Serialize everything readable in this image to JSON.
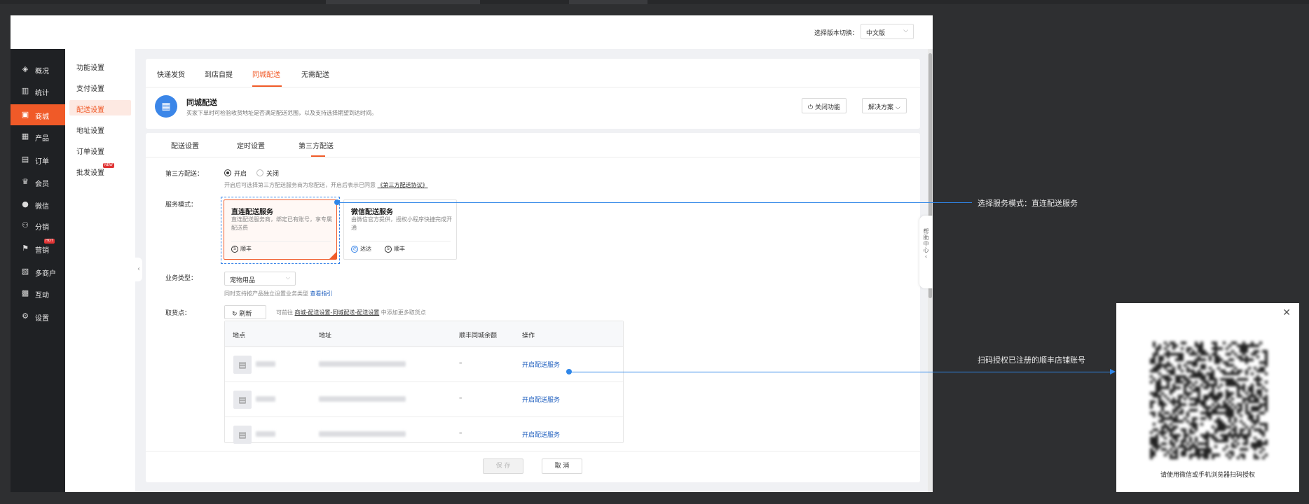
{
  "header": {
    "lang_label": "选择版本切换：",
    "lang_value": "中文版"
  },
  "sidebar": {
    "items": [
      {
        "label": "概况",
        "icon": "layers-icon",
        "glyph": "◈"
      },
      {
        "label": "统计",
        "icon": "chart-icon",
        "glyph": "▥"
      },
      {
        "label": "商城",
        "icon": "shop-icon",
        "glyph": "▣"
      },
      {
        "label": "产品",
        "icon": "grid-icon",
        "glyph": "▦"
      },
      {
        "label": "订单",
        "icon": "order-icon",
        "glyph": "▤"
      },
      {
        "label": "会员",
        "icon": "crown-icon",
        "glyph": "♛"
      },
      {
        "label": "微信",
        "icon": "wechat-icon",
        "glyph": "●"
      },
      {
        "label": "分销",
        "icon": "distribution-icon",
        "glyph": "⚇"
      },
      {
        "label": "营销",
        "icon": "flag-icon",
        "glyph": "⚑",
        "badge": "HOT"
      },
      {
        "label": "多商户",
        "icon": "merchant-icon",
        "glyph": "▧"
      },
      {
        "label": "互动",
        "icon": "interact-icon",
        "glyph": "▩"
      },
      {
        "label": "设置",
        "icon": "gear-icon",
        "glyph": "⚙"
      }
    ]
  },
  "subnav": {
    "items": [
      {
        "label": "功能设置"
      },
      {
        "label": "支付设置"
      },
      {
        "label": "配送设置"
      },
      {
        "label": "地址设置"
      },
      {
        "label": "订单设置"
      },
      {
        "label": "批发设置",
        "badge": "NEW"
      }
    ]
  },
  "tabs": [
    "快递发货",
    "到店自提",
    "同城配送",
    "无需配送"
  ],
  "feature": {
    "title": "同城配送",
    "desc": "买家下单时可检验收货地址是否满足配送范围，以及支持选择期望到达时间。",
    "close_label": "关闭功能",
    "solution_label": "解决方案"
  },
  "subtabs": [
    "配送设置",
    "定时设置",
    "第三方配送"
  ],
  "form": {
    "third_party_label": "第三方配送：",
    "on_label": "开启",
    "off_label": "关闭",
    "third_party_help": "开启后可选择第三方配送服务商为您配送，开启后表示已同意",
    "protocol_link": "《第三方配送协议》",
    "service_mode_label": "服务模式：",
    "service_cards": [
      {
        "title": "直连配送服务",
        "desc": "直连配送服务商，绑定已有账号，享专属配送费",
        "logos": [
          "顺丰"
        ]
      },
      {
        "title": "微信配送服务",
        "desc": "由微信官方提供，授权小程序快捷完成开通",
        "logos": [
          "达达",
          "顺丰"
        ]
      }
    ],
    "biz_type_label": "业务类型：",
    "biz_type_value": "宠物用品",
    "biz_help": "同时支持按产品独立设置业务类型",
    "biz_help_link": "查看指引",
    "pickup_label": "取货点：",
    "refresh_label": "刷新",
    "pickup_help_pre": "可前往",
    "pickup_help_link": "商城-配送设置-同城配送-配送设置",
    "pickup_help_post": "中添加更多取货点"
  },
  "table": {
    "headers": [
      "地点",
      "地址",
      "顺丰同城余额",
      "操作"
    ],
    "rows": [
      {
        "balance": "–",
        "action": "开启配送服务"
      },
      {
        "balance": "–",
        "action": "开启配送服务"
      },
      {
        "balance": "–",
        "action": "开启配送服务"
      }
    ]
  },
  "footer": {
    "save_label": "保 存",
    "cancel_label": "取 消"
  },
  "help_side": "帮助中心",
  "annotations": {
    "service_mode_note": "选择服务模式：直连配送服务",
    "scan_note": "扫码授权已注册的顺丰店铺账号"
  },
  "qr": {
    "caption": "请使用微信或手机浏览器扫码授权"
  },
  "colors": {
    "accent": "#f05a28",
    "annotation": "#2f86e8",
    "link": "#1f5fbf",
    "sidebar_bg": "#1f2124"
  }
}
